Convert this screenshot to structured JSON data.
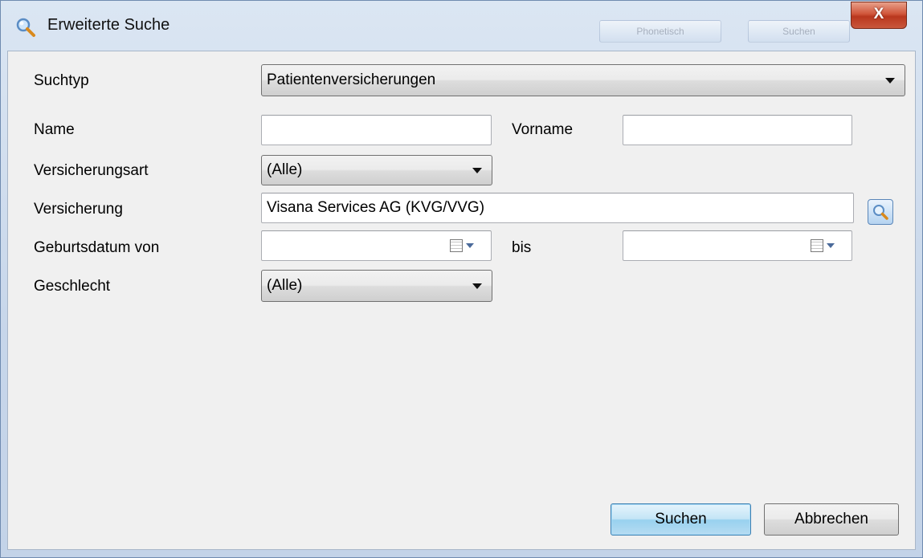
{
  "window": {
    "title": "Erweiterte Suche",
    "close_label": "X",
    "background_buttons": [
      "Phonetisch",
      "Suchen"
    ]
  },
  "form": {
    "suchtyp": {
      "label": "Suchtyp",
      "value": "Patientenversicherungen"
    },
    "name": {
      "label": "Name",
      "value": ""
    },
    "vorname": {
      "label": "Vorname",
      "value": ""
    },
    "versicherungsart": {
      "label": "Versicherungsart",
      "value": "(Alle)"
    },
    "versicherung": {
      "label": "Versicherung",
      "value": "Visana Services AG (KVG/VVG)"
    },
    "geburtsdatum_von": {
      "label": "Geburtsdatum von",
      "value": ""
    },
    "geburtsdatum_bis": {
      "label": "bis",
      "value": ""
    },
    "geschlecht": {
      "label": "Geschlecht",
      "value": "(Alle)"
    }
  },
  "buttons": {
    "search": "Suchen",
    "cancel": "Abbrechen"
  },
  "icons": {
    "title": "magnifier-icon",
    "lookup": "magnifier-icon",
    "date": "calendar-icon"
  },
  "colors": {
    "primary_button": "#c4e5f6",
    "close_button": "#c9452a",
    "dialog_background": "#f0f0f0"
  }
}
